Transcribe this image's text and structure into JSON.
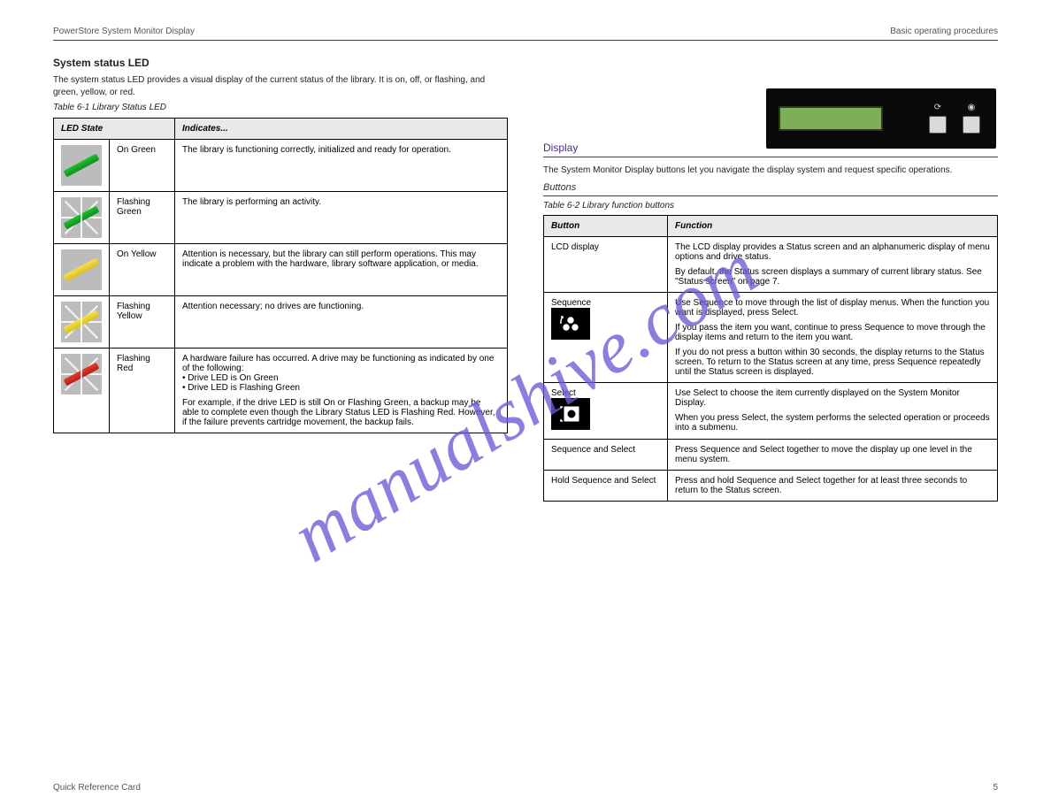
{
  "header": {
    "left": "PowerStore System Monitor Display",
    "right": "Basic operating procedures"
  },
  "watermark": "manualshive.com",
  "left": {
    "sectionTitle": "System status LED",
    "intro": "The system status LED provides a visual display of the current status of the library. It is on, off, or flashing, and green, yellow, or red.",
    "tableCaption": "Table 6-1  Library Status LED",
    "table": {
      "headers": [
        "LED State",
        "Indicates..."
      ],
      "rows": [
        {
          "state": "On Green",
          "desc": "The library is functioning correctly, initialized and ready for operation."
        },
        {
          "state": "Flashing Green",
          "desc": "The library is performing an activity."
        },
        {
          "state": "On Yellow",
          "desc": "Attention is necessary, but the library can still perform operations. This may indicate a problem with the hardware, library software application, or media."
        },
        {
          "state": "Flashing Yellow",
          "desc": "Attention necessary; no drives are functioning."
        },
        {
          "state": "Flashing Red",
          "desc": [
            "A hardware failure has occurred. A drive may be functioning as indicated by one of the following:",
            "• Drive LED is On Green",
            "• Drive LED is Flashing Green",
            "For example, if the drive LED is still On or Flashing Green, a backup may be able to complete even though the Library Status LED is Flashing Red. However, if the failure prevents cartridge movement, the backup fails."
          ]
        }
      ]
    }
  },
  "right": {
    "displayHeading": "Display",
    "displaySub": "Buttons",
    "displayIntro": "The System Monitor Display buttons let you navigate the display system and request specific operations.",
    "tableCaption": "Table 6-2  Library function buttons",
    "lcdAlt": "LCD control panel with screen and two buttons",
    "table": {
      "headers": [
        "Button",
        "Function"
      ],
      "rows": [
        {
          "button": "LCD display",
          "func": [
            "The LCD display provides a Status screen and an alphanumeric display of menu options and drive status.",
            "By default, the Status screen displays a summary of current library status. See \"Status screen\" on page 7."
          ]
        },
        {
          "button": "Sequence",
          "icon": "sequence",
          "func": [
            "Use Sequence to move through the list of display menus. When the function you want is displayed, press Select.",
            "If you pass the item you want, continue to press Sequence to move through the display items and return to the item you want.",
            "If you do not press a button within 30 seconds, the display returns to the Status screen. To return to the Status screen at any time, press Sequence repeatedly until the Status screen is displayed."
          ]
        },
        {
          "button": "Select",
          "icon": "select",
          "func": [
            "Use Select to choose the item currently displayed on the System Monitor Display.",
            "When you press Select, the system performs the selected operation or proceeds into a submenu."
          ]
        },
        {
          "button": "Sequence and Select",
          "func": [
            "Press Sequence and Select together to move the display up one level in the menu system."
          ]
        },
        {
          "button": "Hold Sequence and Select",
          "func": [
            "Press and hold Sequence and Select together for at least three seconds to return to the Status screen."
          ]
        }
      ]
    }
  },
  "footer": {
    "left": "Quick Reference Card",
    "right": "5"
  }
}
